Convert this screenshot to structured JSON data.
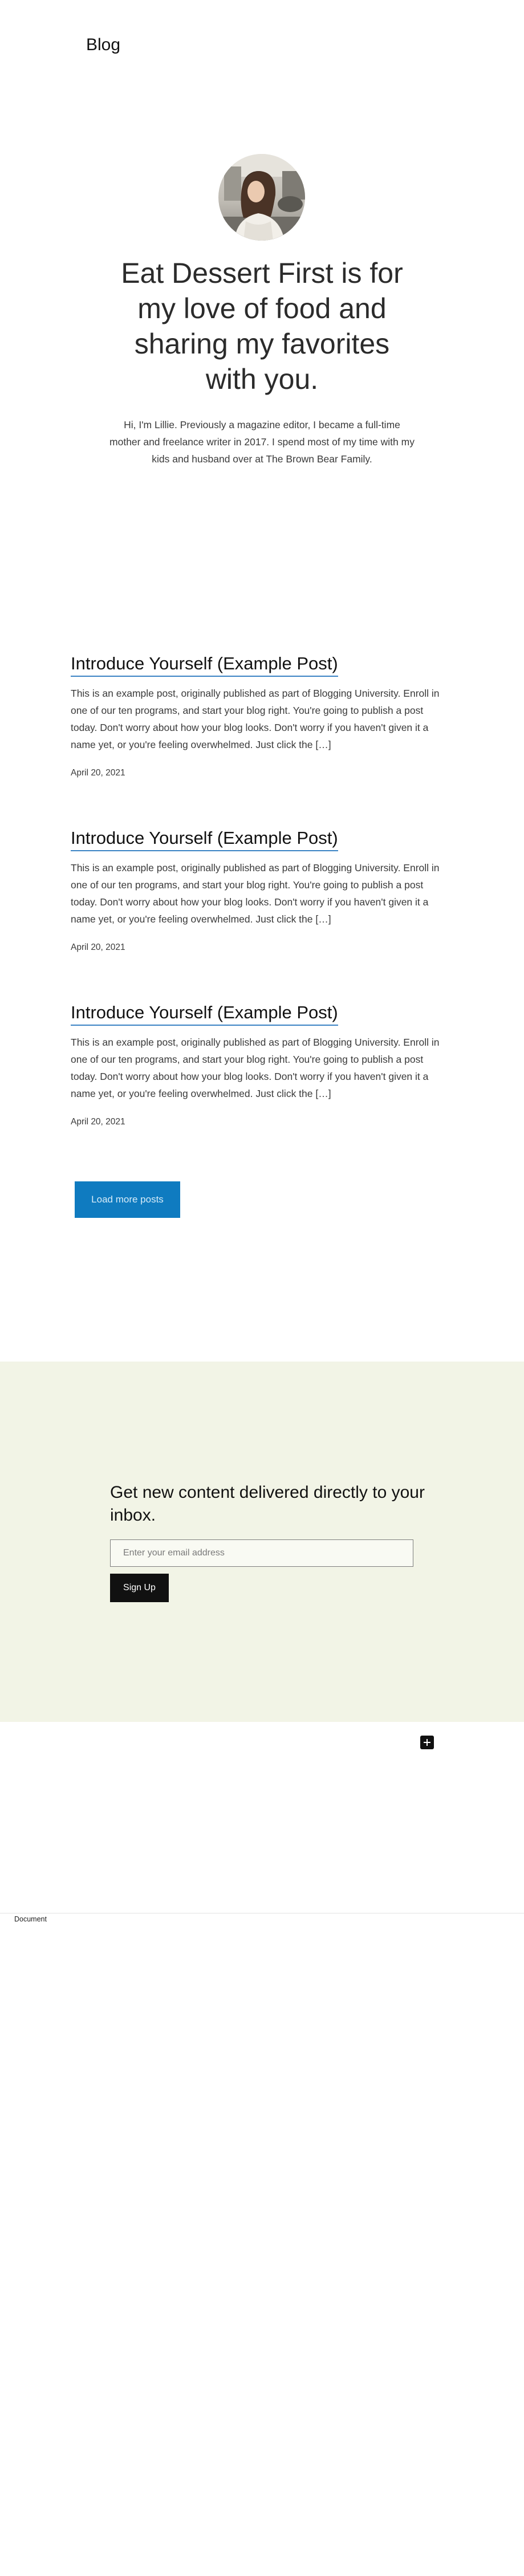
{
  "site": {
    "title": "Blog"
  },
  "hero": {
    "avatar_icon": "profile-photo",
    "heading": "Eat Dessert First is for my love of food and sharing my favorites with you.",
    "intro": "Hi, I'm Lillie. Previously a magazine editor, I became a full-time mother and freelance writer in 2017. I spend most of my time with my kids and husband over at The Brown Bear Family."
  },
  "posts": [
    {
      "title": "Introduce Yourself (Example Post)",
      "excerpt": "This is an example post, originally published as part of Blogging University. Enroll in one of our ten programs, and start your blog right. You're going to publish a post today. Don't worry about how your blog looks. Don't worry if you haven't given it a name yet, or you're feeling overwhelmed. Just click the […]",
      "date": "April 20, 2021"
    },
    {
      "title": "Introduce Yourself (Example Post)",
      "excerpt": "This is an example post, originally published as part of Blogging University. Enroll in one of our ten programs, and start your blog right. You're going to publish a post today. Don't worry about how your blog looks. Don't worry if you haven't given it a name yet, or you're feeling overwhelmed. Just click the […]",
      "date": "April 20, 2021"
    },
    {
      "title": "Introduce Yourself (Example Post)",
      "excerpt": "This is an example post, originally published as part of Blogging University. Enroll in one of our ten programs, and start your blog right. You're going to publish a post today. Don't worry about how your blog looks. Don't worry if you haven't given it a name yet, or you're feeling overwhelmed. Just click the […]",
      "date": "April 20, 2021"
    }
  ],
  "pagination": {
    "load_more_label": "Load more posts"
  },
  "subscribe": {
    "heading": "Get new content delivered directly to your inbox.",
    "email_placeholder": "Enter your email address",
    "signup_label": "Sign Up"
  },
  "editor": {
    "add_block_icon": "plus-icon",
    "document_label": "Document"
  },
  "colors": {
    "accent": "#0f7bc0",
    "link_underline": "#3a83c4",
    "subscribe_background": "#f2f4e6",
    "button_dark": "#111111"
  }
}
